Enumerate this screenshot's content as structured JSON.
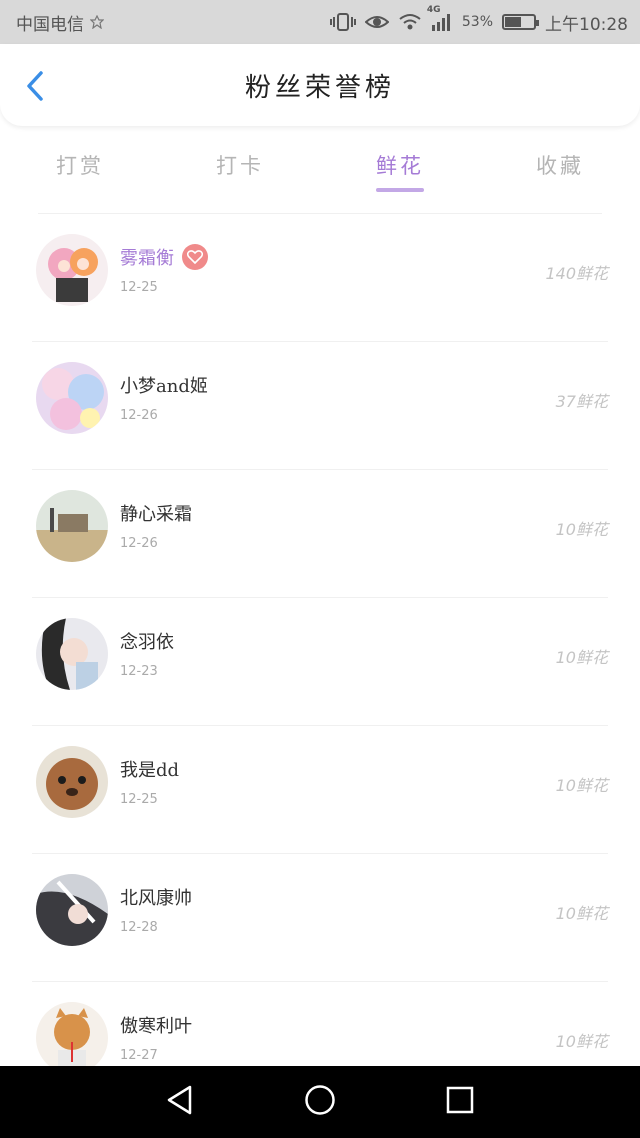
{
  "status_bar": {
    "carrier": "中国电信",
    "network": "4G",
    "battery": "53%",
    "battery_level": 0.53,
    "time": "上午10:28"
  },
  "header": {
    "title": "粉丝荣誉榜"
  },
  "tabs": [
    {
      "label": "打赏",
      "active": false
    },
    {
      "label": "打卡",
      "active": false
    },
    {
      "label": "鲜花",
      "active": true
    },
    {
      "label": "收藏",
      "active": false
    }
  ],
  "fans": [
    {
      "name": "雾霜衡",
      "date": "12-25",
      "amount": "140鲜花",
      "highlight": true,
      "badge": true
    },
    {
      "name": "小梦and姬",
      "date": "12-26",
      "amount": "37鲜花",
      "highlight": false,
      "badge": false
    },
    {
      "name": "静心采霜",
      "date": "12-26",
      "amount": "10鲜花",
      "highlight": false,
      "badge": false
    },
    {
      "name": "念羽依",
      "date": "12-23",
      "amount": "10鲜花",
      "highlight": false,
      "badge": false
    },
    {
      "name": "我是dd",
      "date": "12-25",
      "amount": "10鲜花",
      "highlight": false,
      "badge": false
    },
    {
      "name": "北风康帅",
      "date": "12-28",
      "amount": "10鲜花",
      "highlight": false,
      "badge": false
    },
    {
      "name": "傲寒利叶",
      "date": "12-27",
      "amount": "10鲜花",
      "highlight": false,
      "badge": false
    }
  ],
  "colors": {
    "accent": "#a57bd6",
    "tab_inactive": "#b5b5b5",
    "badge": "#f08a8a",
    "back_arrow": "#3a8ee6"
  },
  "icons": {
    "back": "chevron-left-icon",
    "badge": "heart-badge-icon",
    "nav_back": "triangle-back-icon",
    "nav_home": "circle-home-icon",
    "nav_recent": "square-recent-icon"
  }
}
